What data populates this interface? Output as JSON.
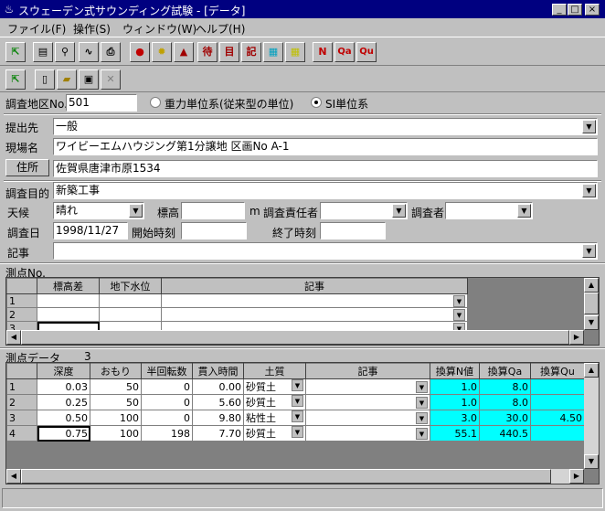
{
  "window": {
    "title": "スウェーデン式サウンディング試験 - [データ]"
  },
  "menu": [
    "ファイル(F)",
    "操作(S)",
    "ウィンドウ(W)",
    "ヘルプ(H)"
  ],
  "toolbar1": [
    "N",
    "Qa",
    "Qu"
  ],
  "form": {
    "survey_area_label": "調査地区No.",
    "survey_area_value": "501",
    "radio_gravity": "重力単位系(従来型の単位)",
    "radio_si": "SI単位系",
    "submit_to_label": "提出先",
    "submit_to_value": "一般",
    "site_name_label": "現場名",
    "site_name_value": "ワイビーエムハウジング第1分譲地  区画No A-1",
    "address_button": "住所",
    "address_value": "佐賀県唐津市原1534",
    "purpose_label": "調査目的",
    "purpose_value": "新築工事",
    "weather_label": "天候",
    "weather_value": "晴れ",
    "elevation_label": "標高",
    "elevation_unit": "m",
    "manager_label": "調査責任者",
    "investigator_label": "調査者",
    "date_label": "調査日",
    "date_value": "1998/11/27",
    "start_time_label": "開始時刻",
    "end_time_label": "終了時刻",
    "notes_label": "記事"
  },
  "points": {
    "title": "測点No.",
    "headers": [
      "標高差",
      "地下水位",
      "記事"
    ],
    "rows": [
      "1",
      "2",
      "3"
    ]
  },
  "measurements": {
    "title": "測点データ",
    "count": "3",
    "headers": [
      "深度",
      "おもり",
      "半回転数",
      "貫入時間",
      "土質",
      "記事",
      "換算N値",
      "換算Qa",
      "換算Qu"
    ],
    "rows": [
      {
        "no": "1",
        "depth": "0.03",
        "weight": "50",
        "half_turns": "0",
        "time": "0.00",
        "soil": "砂質土",
        "note": "",
        "n": "1.0",
        "qa": "8.0",
        "qu": ""
      },
      {
        "no": "2",
        "depth": "0.25",
        "weight": "50",
        "half_turns": "0",
        "time": "5.60",
        "soil": "砂質土",
        "note": "",
        "n": "1.0",
        "qa": "8.0",
        "qu": ""
      },
      {
        "no": "3",
        "depth": "0.50",
        "weight": "100",
        "half_turns": "0",
        "time": "9.80",
        "soil": "粘性土",
        "note": "",
        "n": "3.0",
        "qa": "30.0",
        "qu": "4.50"
      },
      {
        "no": "4",
        "depth": "0.75",
        "weight": "100",
        "half_turns": "198",
        "time": "7.70",
        "soil": "砂質土",
        "note": "",
        "n": "55.1",
        "qa": "440.5",
        "qu": ""
      }
    ]
  },
  "colors": {
    "titlebar": "#000080",
    "calc_cells": "#00ffff",
    "face": "#c0c0c0"
  }
}
